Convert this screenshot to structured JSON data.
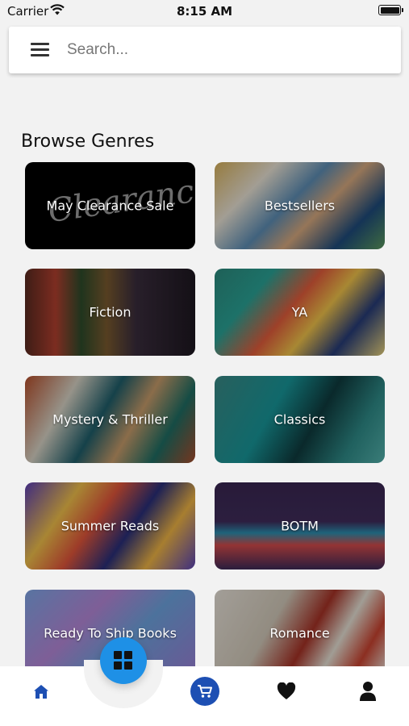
{
  "status_bar": {
    "carrier": "Carrier",
    "time": "8:15 AM"
  },
  "search": {
    "placeholder": "Search..."
  },
  "section": {
    "title": "Browse Genres"
  },
  "genres": [
    {
      "label": "May Clearance Sale",
      "script_text": "Clearance"
    },
    {
      "label": "Bestsellers"
    },
    {
      "label": "Fiction"
    },
    {
      "label": "YA"
    },
    {
      "label": "Mystery & Thriller"
    },
    {
      "label": "Classics"
    },
    {
      "label": "Summer Reads"
    },
    {
      "label": "BOTM"
    },
    {
      "label": "Ready To Ship Books"
    },
    {
      "label": "Romance"
    }
  ],
  "bottom_nav": {
    "items": [
      "home-icon",
      "grid-icon",
      "cart-icon",
      "heart-icon",
      "user-icon"
    ],
    "colors": {
      "active": "#1d4fb3",
      "fab": "#1e90e6",
      "icon": "#111111"
    }
  }
}
